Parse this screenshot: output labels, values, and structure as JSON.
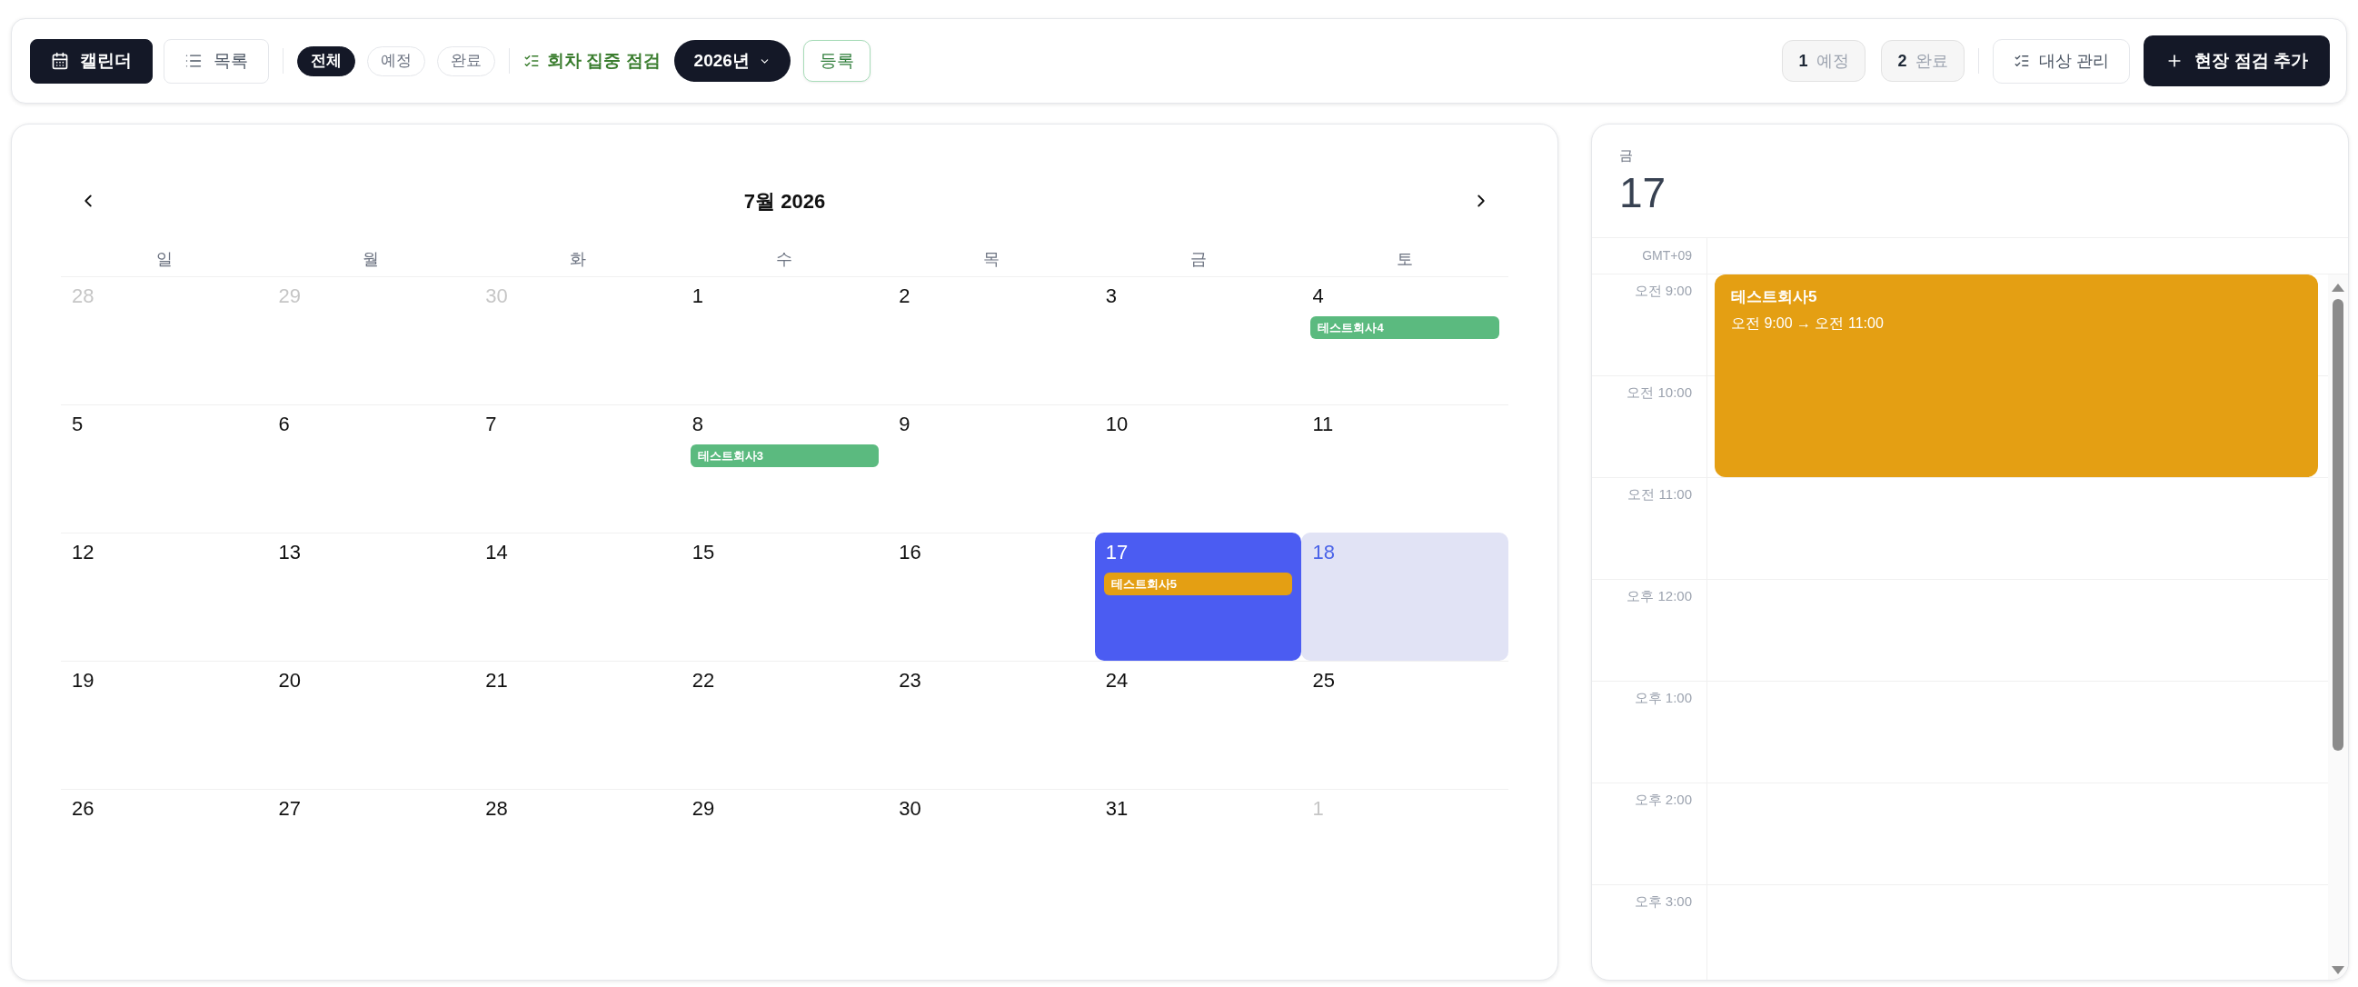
{
  "toolbar": {
    "view_tabs": [
      {
        "kind": "calendar",
        "label": "캘린더",
        "selected": true
      },
      {
        "kind": "list",
        "label": "목록",
        "selected": false
      }
    ],
    "filters": [
      {
        "label": "전체",
        "selected": true
      },
      {
        "label": "예정",
        "selected": false
      },
      {
        "label": "완료",
        "selected": false
      }
    ],
    "focus_toggle": {
      "label": "회차 집중 점검",
      "on": true
    },
    "year_select": {
      "value": "2026년"
    },
    "register_button": {
      "label": "등록"
    },
    "counts": [
      {
        "number": "1",
        "label": "예정"
      },
      {
        "number": "2",
        "label": "완료"
      }
    ],
    "manage_button": {
      "label": "대상 관리"
    },
    "add_button": {
      "label": "현장 점검 추가"
    }
  },
  "calendar": {
    "title": "7월 2026",
    "weekdays": [
      "일",
      "월",
      "화",
      "수",
      "목",
      "금",
      "토"
    ],
    "weeks": [
      [
        {
          "day": "28",
          "outside": true,
          "selected": false,
          "today": false
        },
        {
          "day": "29",
          "outside": true,
          "selected": false,
          "today": false
        },
        {
          "day": "30",
          "outside": true,
          "selected": false,
          "today": false
        },
        {
          "day": "1",
          "outside": false,
          "selected": false,
          "today": false
        },
        {
          "day": "2",
          "outside": false,
          "selected": false,
          "today": false
        },
        {
          "day": "3",
          "outside": false,
          "selected": false,
          "today": false
        },
        {
          "day": "4",
          "outside": false,
          "selected": false,
          "today": false,
          "events": [
            {
              "title": "테스트회사4",
              "color": "#5bba7f"
            }
          ]
        }
      ],
      [
        {
          "day": "5",
          "outside": false,
          "selected": false,
          "today": false
        },
        {
          "day": "6",
          "outside": false,
          "selected": false,
          "today": false
        },
        {
          "day": "7",
          "outside": false,
          "selected": false,
          "today": false
        },
        {
          "day": "8",
          "outside": false,
          "selected": false,
          "today": false,
          "events": [
            {
              "title": "테스트회사3",
              "color": "#5bba7f"
            }
          ]
        },
        {
          "day": "9",
          "outside": false,
          "selected": false,
          "today": false
        },
        {
          "day": "10",
          "outside": false,
          "selected": false,
          "today": false
        },
        {
          "day": "11",
          "outside": false,
          "selected": false,
          "today": false
        }
      ],
      [
        {
          "day": "12",
          "outside": false,
          "selected": false,
          "today": false
        },
        {
          "day": "13",
          "outside": false,
          "selected": false,
          "today": false
        },
        {
          "day": "14",
          "outside": false,
          "selected": false,
          "today": false
        },
        {
          "day": "15",
          "outside": false,
          "selected": false,
          "today": false
        },
        {
          "day": "16",
          "outside": false,
          "selected": false,
          "today": false
        },
        {
          "day": "17",
          "outside": false,
          "selected": true,
          "today": false,
          "events": [
            {
              "title": "테스트회사5",
              "color": "#e49f13"
            }
          ]
        },
        {
          "day": "18",
          "outside": false,
          "selected": false,
          "today": true
        }
      ],
      [
        {
          "day": "19",
          "outside": false,
          "selected": false,
          "today": false
        },
        {
          "day": "20",
          "outside": false,
          "selected": false,
          "today": false
        },
        {
          "day": "21",
          "outside": false,
          "selected": false,
          "today": false
        },
        {
          "day": "22",
          "outside": false,
          "selected": false,
          "today": false
        },
        {
          "day": "23",
          "outside": false,
          "selected": false,
          "today": false
        },
        {
          "day": "24",
          "outside": false,
          "selected": false,
          "today": false
        },
        {
          "day": "25",
          "outside": false,
          "selected": false,
          "today": false
        }
      ],
      [
        {
          "day": "26",
          "outside": false,
          "selected": false,
          "today": false
        },
        {
          "day": "27",
          "outside": false,
          "selected": false,
          "today": false
        },
        {
          "day": "28",
          "outside": false,
          "selected": false,
          "today": false
        },
        {
          "day": "29",
          "outside": false,
          "selected": false,
          "today": false
        },
        {
          "day": "30",
          "outside": false,
          "selected": false,
          "today": false
        },
        {
          "day": "31",
          "outside": false,
          "selected": false,
          "today": false
        },
        {
          "day": "1",
          "outside": true,
          "selected": false,
          "today": false
        }
      ]
    ]
  },
  "day_panel": {
    "weekday": "금",
    "day": "17",
    "timezone": "GMT+09",
    "hours": [
      "오전 9:00",
      "오전 10:00",
      "오전 11:00",
      "오후 12:00",
      "오후 1:00",
      "오후 2:00",
      "오후 3:00"
    ],
    "events": [
      {
        "title": "테스트회사5",
        "time": "오전 9:00 → 오전 11:00",
        "color": "#e49f13"
      }
    ]
  }
}
